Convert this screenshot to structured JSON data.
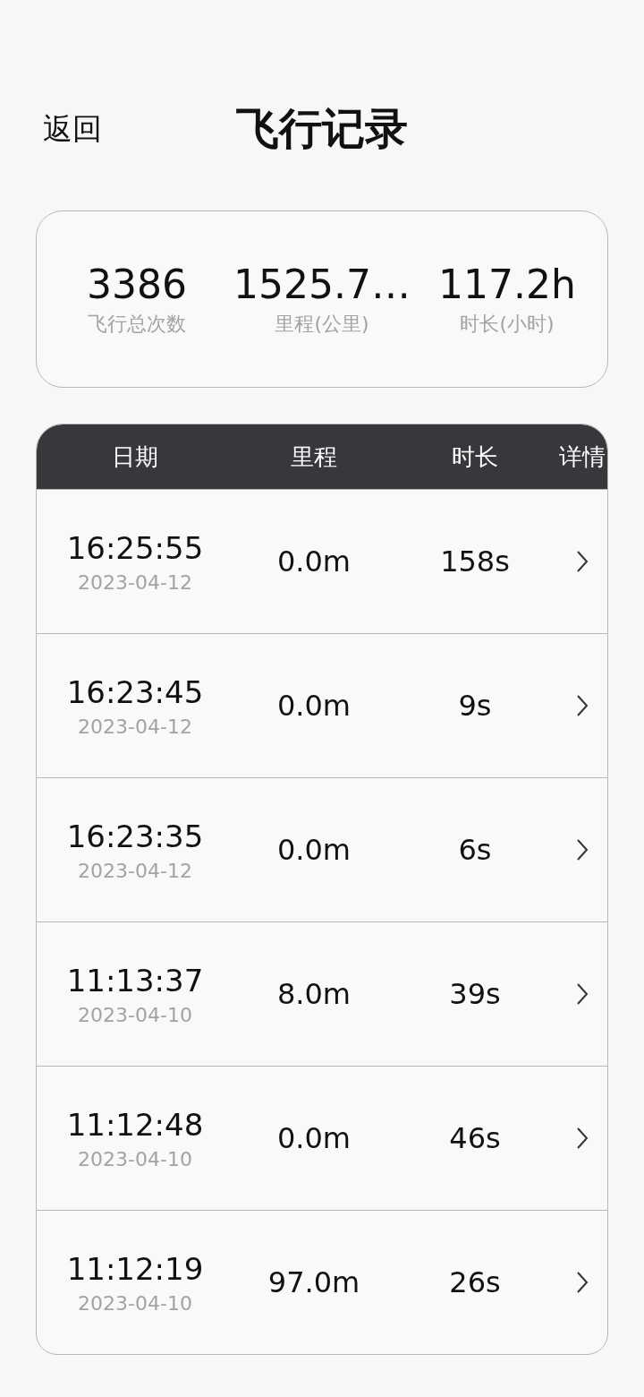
{
  "header": {
    "back": "返回",
    "title": "飞行记录"
  },
  "summary": [
    {
      "value": "3386",
      "label": "飞行总次数"
    },
    {
      "value": "1525.7…",
      "label": "里程(公里)"
    },
    {
      "value": "117.2h",
      "label": "时长(小时)"
    }
  ],
  "table": {
    "columns": [
      "日期",
      "里程",
      "时长",
      "详情"
    ],
    "rows": [
      {
        "time": "16:25:55",
        "date": "2023-04-12",
        "distance": "0.0m",
        "duration": "158s"
      },
      {
        "time": "16:23:45",
        "date": "2023-04-12",
        "distance": "0.0m",
        "duration": "9s"
      },
      {
        "time": "16:23:35",
        "date": "2023-04-12",
        "distance": "0.0m",
        "duration": "6s"
      },
      {
        "time": "11:13:37",
        "date": "2023-04-10",
        "distance": "8.0m",
        "duration": "39s"
      },
      {
        "time": "11:12:48",
        "date": "2023-04-10",
        "distance": "0.0m",
        "duration": "46s"
      },
      {
        "time": "11:12:19",
        "date": "2023-04-10",
        "distance": "97.0m",
        "duration": "26s"
      }
    ]
  }
}
